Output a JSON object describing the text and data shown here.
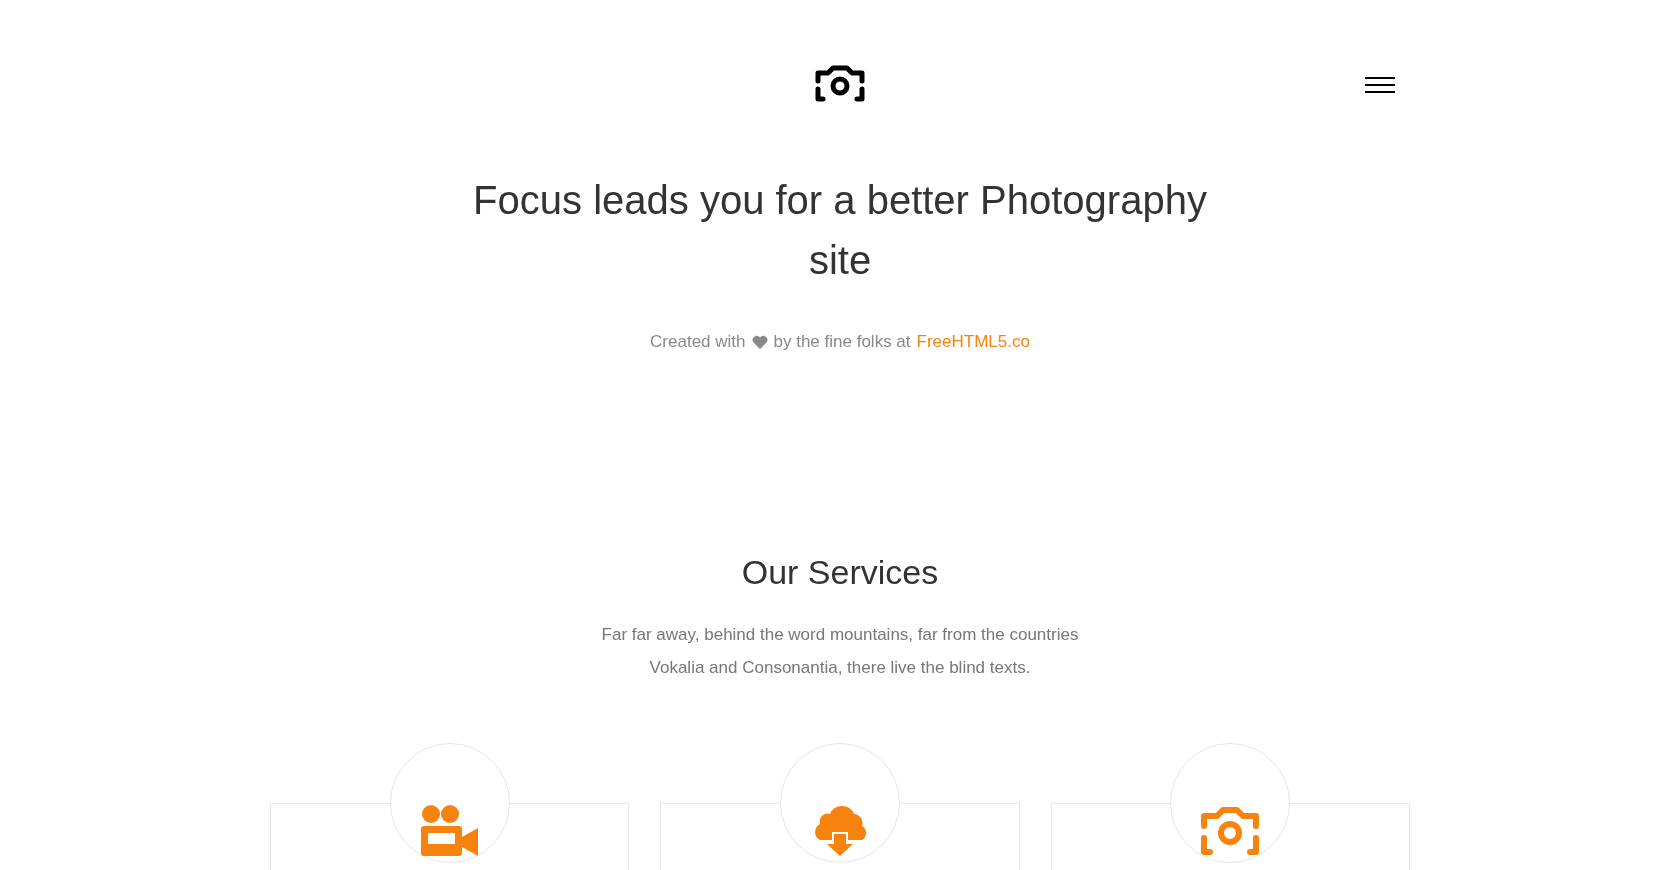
{
  "hero": {
    "title": "Focus leads you for a better Photography site",
    "credit_prefix": "Created with",
    "credit_suffix": "by the fine folks at",
    "credit_link": "FreeHTML5.co"
  },
  "services": {
    "title": "Our Services",
    "description": "Far far away, behind the word mountains, far from the countries Vokalia and Consonantia, there live the blind texts.",
    "cards": [
      {
        "kind": "video"
      },
      {
        "kind": "cloud-download"
      },
      {
        "kind": "camera"
      }
    ]
  }
}
